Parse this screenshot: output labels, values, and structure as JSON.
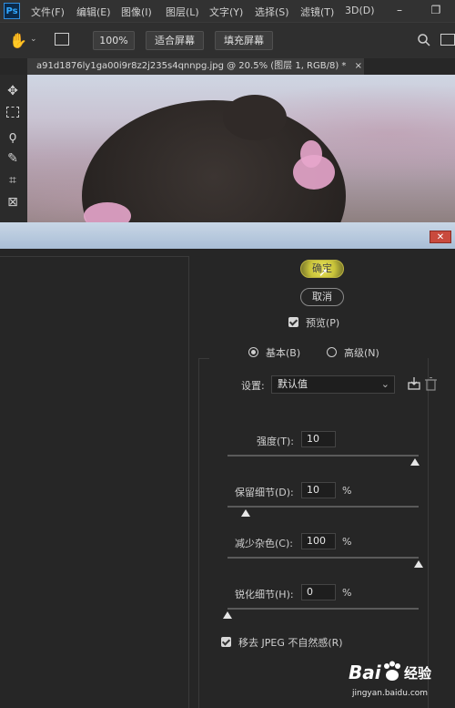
{
  "app": {
    "logo_text": "Ps"
  },
  "menubar": {
    "items": [
      "文件(F)",
      "编辑(E)",
      "图像(I)",
      "图层(L)",
      "文字(Y)",
      "选择(S)",
      "滤镜(T)",
      "3D(D)"
    ],
    "minimize_label": "–",
    "restore_label": "❐"
  },
  "options_bar": {
    "zoom_label": "100%",
    "fit_screen_label": "适合屏幕",
    "fill_screen_label": "填充屏幕"
  },
  "document_tab": {
    "title": "a91d1876ly1ga00i9r8z2j235s4qnnpg.jpg @ 20.5% (图层 1, RGB/8) *",
    "close_label": "×"
  },
  "dialog": {
    "close_label": "✕",
    "ok_label": "确定",
    "cancel_label": "取消",
    "preview_label": "预览(P)",
    "preview_checked": true,
    "mode_basic_label": "基本(B)",
    "mode_advanced_label": "高级(N)",
    "mode_selected": "basic",
    "settings_label": "设置:",
    "settings_value": "默认值",
    "strength": {
      "label": "强度(T):",
      "value": "10",
      "unit": "",
      "slider_fraction": 1.0
    },
    "preserve_details": {
      "label": "保留细节(D):",
      "value": "10",
      "unit": "%",
      "slider_fraction": 0.1
    },
    "reduce_color_noise": {
      "label": "减少杂色(C):",
      "value": "100",
      "unit": "%",
      "slider_fraction": 1.0
    },
    "sharpen_details": {
      "label": "锐化细节(H):",
      "value": "0",
      "unit": "%",
      "slider_fraction": 0.0
    },
    "remove_jpeg_label": "移去 JPEG 不自然感(R)",
    "remove_jpeg_checked": true
  },
  "watermark": {
    "brand": "Bai",
    "brand_suffix": "经验",
    "url": "jingyan.baidu.com"
  }
}
